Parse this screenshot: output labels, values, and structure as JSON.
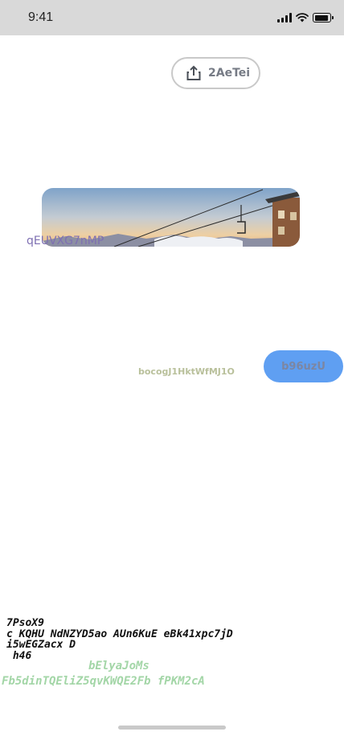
{
  "status_bar": {
    "time": "9:41",
    "icons": [
      "cellular-signal-icon",
      "wifi-icon",
      "battery-icon"
    ]
  },
  "share_button": {
    "label": "2AeTei",
    "icon": "share-upload-icon"
  },
  "photo_card": {
    "caption": "qEUVXG7nMP"
  },
  "inline_link": {
    "text": "bocogJ1HktWfMJ1O"
  },
  "action_button": {
    "label": "b96uzU",
    "color": "#5f9ff2"
  },
  "text_block": {
    "lines": [
      "7PsoX9",
      "c KQHU NdNZYD5ao AUn6KuE eBk41xpc7jD",
      "i5wEGZacx D",
      " h46"
    ]
  },
  "green_text": {
    "title": "bElyaJoMs",
    "line": "Fb5dinTQEliZ5qvKWQE2Fb fPKM2cA",
    "color": "#a3d6a7"
  }
}
